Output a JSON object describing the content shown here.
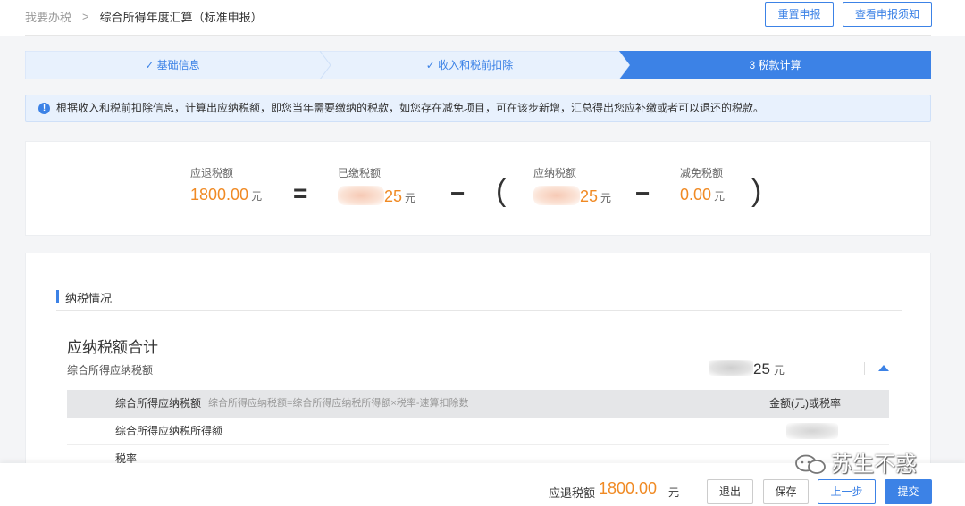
{
  "breadcrumb": {
    "home": "我要办税",
    "current": "综合所得年度汇算（标准申报）"
  },
  "header": {
    "reset_label": "重置申报",
    "notice_label": "查看申报须知"
  },
  "steps": [
    {
      "label": "✓ 基础信息",
      "state": "done"
    },
    {
      "label": "✓ 收入和税前扣除",
      "state": "done"
    },
    {
      "label": "3  税款计算",
      "state": "active"
    }
  ],
  "notice": {
    "text": "根据收入和税前扣除信息，计算出应纳税额，即您当年需要缴纳的税款，如您存在减免项目，可在该步新增，汇总得出您应补缴或者可以退还的税款。"
  },
  "formula": {
    "refund": {
      "label": "应退税额",
      "value": "1800.00",
      "unit": "元"
    },
    "paid": {
      "label": "已缴税额",
      "value": "25",
      "unit": "元"
    },
    "payable": {
      "label": "应纳税额",
      "value": "25",
      "unit": "元"
    },
    "exempt": {
      "label": "减免税额",
      "value": "0.00",
      "unit": "元"
    },
    "eq": "=",
    "minus": "−",
    "lparen": "(",
    "rparen": ")"
  },
  "section": {
    "title": "纳税情况",
    "total_title": "应纳税额合计",
    "total_sub": "综合所得应纳税额",
    "total_value": "25",
    "total_unit": "元",
    "table": {
      "header": {
        "name": "综合所得应纳税额",
        "formula": "综合所得应纳税额=综合所得应纳税所得额×税率-速算扣除数",
        "col2": "金额(元)或税率"
      },
      "rows": [
        {
          "name": "综合所得应纳税所得额"
        },
        {
          "name": "税率"
        }
      ]
    }
  },
  "footer": {
    "label": "应退税额",
    "amount": "1800.00",
    "unit": "元",
    "exit_label": "退出",
    "save_label": "保存",
    "prev_label": "上一步",
    "submit_label": "提交"
  },
  "watermark": {
    "text": "苏生不惑"
  },
  "colors": {
    "accent": "#3c82e6",
    "amount": "#f08a24",
    "step_done_bg": "#e8f1fd"
  }
}
